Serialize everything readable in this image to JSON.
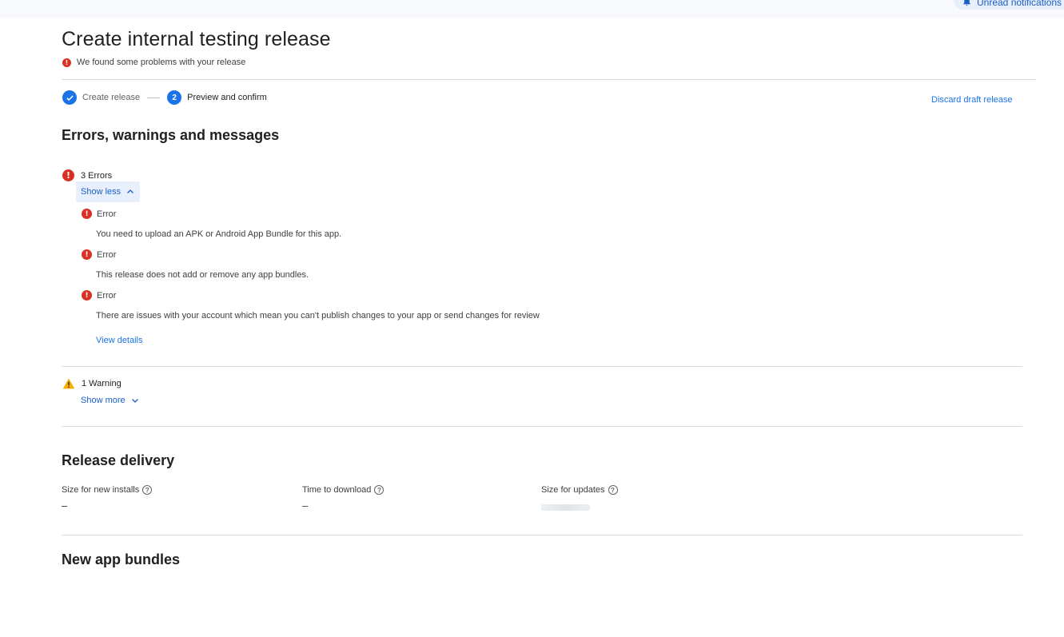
{
  "header": {
    "notifications_label": "Unread notifications"
  },
  "page": {
    "title": "Create internal testing release",
    "problem_message": "We found some problems with your release"
  },
  "stepper": {
    "steps": [
      {
        "label": "Create release",
        "state": "done"
      },
      {
        "number": "2",
        "label": "Preview and confirm",
        "state": "active"
      }
    ],
    "discard_label": "Discard draft release"
  },
  "errors_section": {
    "title": "Errors, warnings and messages",
    "errors": {
      "summary": "3 Errors",
      "toggle_label": "Show less",
      "items": [
        {
          "title": "Error",
          "description": "You need to upload an APK or Android App Bundle for this app."
        },
        {
          "title": "Error",
          "description": "This release does not add or remove any app bundles."
        },
        {
          "title": "Error",
          "description": "There are issues with your account which mean you can't publish changes to your app or send changes for review"
        }
      ],
      "view_details_label": "View details"
    },
    "warnings": {
      "summary": "1 Warning",
      "toggle_label": "Show more"
    }
  },
  "release_delivery": {
    "title": "Release delivery",
    "stats": [
      {
        "label": "Size for new installs",
        "value": "–"
      },
      {
        "label": "Time to download",
        "value": "–"
      },
      {
        "label": "Size for updates",
        "value": ""
      }
    ]
  },
  "new_app_bundles": {
    "title": "New app bundles"
  },
  "colors": {
    "accent": "#1a73e8",
    "error": "#d93025",
    "warning": "#f9ab00"
  }
}
